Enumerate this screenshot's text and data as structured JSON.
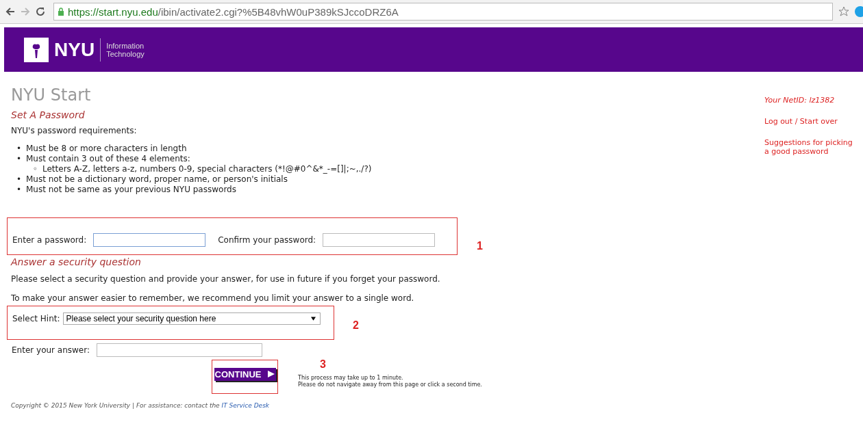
{
  "browser": {
    "url_host": "https://start.nyu.edu",
    "url_path": "/ibin/activate2.cgi?%5B48vhW0uP389kSJccoDRZ6A"
  },
  "header": {
    "logo": "NYU",
    "subtitle_1": "Information",
    "subtitle_2": "Technology"
  },
  "page_title": "NYU Start",
  "section_1": "Set A Password",
  "requirements_intro": "NYU's password requirements:",
  "requirements": [
    {
      "marker": "•",
      "text": "Must be 8 or more characters in length"
    },
    {
      "marker": "•",
      "text": "Must contain 3 out of these 4 elements:",
      "children": [
        {
          "marker": "◦",
          "text": "Letters A-Z, letters a-z, numbers 0-9, special characters (*!@#0^&*_-=[]|;~,./?)"
        }
      ]
    },
    {
      "marker": "•",
      "text": "Must not be a dictionary word, proper name, or person's initials"
    },
    {
      "marker": "•",
      "text": "Must not be same as your previous NYU passwords"
    }
  ],
  "password_label": "Enter a password:",
  "confirm_label": "Confirm your password:",
  "section_2": "Answer a security question",
  "paragraph_1": "Please select a security question and provide your answer, for use in future if you forget your password.",
  "paragraph_2": "To make your answer easier to remember, we recommend you limit your answer to a single word.",
  "hint_label": "Select Hint:",
  "hint_value": "Please select your security question here",
  "answer_label": "Enter your answer:",
  "continue_button": "CONTINUE",
  "note_1": "This process may take up to 1 minute.",
  "note_2": "Please do not navigate away from this page or click a second time.",
  "annotations": [
    "1",
    "2",
    "3"
  ],
  "footer": {
    "text": "Copyright © 2015 New York University | For assistance: contact the ",
    "link": "IT Service Desk"
  },
  "sidebar": {
    "netid": "Your NetID: lz1382",
    "logout": "Log out / Start over",
    "suggestions": "Suggestions for picking a good password"
  }
}
